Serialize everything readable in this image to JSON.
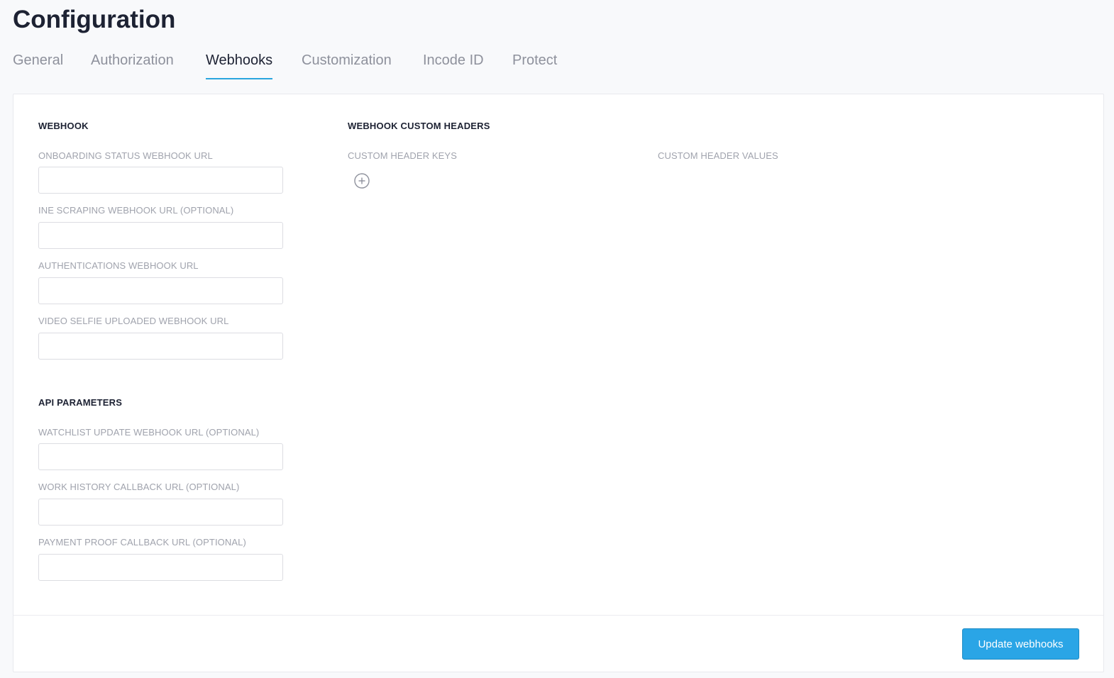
{
  "page": {
    "title": "Configuration"
  },
  "tabs": [
    {
      "label": "General",
      "active": false
    },
    {
      "label": "Authorization",
      "active": false
    },
    {
      "label": "Webhooks",
      "active": true
    },
    {
      "label": "Customization",
      "active": false
    },
    {
      "label": "Incode ID",
      "active": false
    },
    {
      "label": "Protect",
      "active": false
    }
  ],
  "webhook": {
    "title": "WEBHOOK",
    "fields": [
      {
        "label": "ONBOARDING STATUS WEBHOOK URL",
        "value": ""
      },
      {
        "label": "INE SCRAPING WEBHOOK URL (OPTIONAL)",
        "value": ""
      },
      {
        "label": "AUTHENTICATIONS WEBHOOK URL",
        "value": ""
      },
      {
        "label": "VIDEO SELFIE UPLOADED WEBHOOK URL",
        "value": ""
      }
    ]
  },
  "api_parameters": {
    "title": "API PARAMETERS",
    "fields": [
      {
        "label": "WATCHLIST UPDATE WEBHOOK URL (OPTIONAL)",
        "value": ""
      },
      {
        "label": "WORK HISTORY CALLBACK URL (OPTIONAL)",
        "value": ""
      },
      {
        "label": "PAYMENT PROOF CALLBACK URL (OPTIONAL)",
        "value": ""
      }
    ]
  },
  "custom_headers": {
    "title": "WEBHOOK CUSTOM HEADERS",
    "keys_label": "CUSTOM HEADER KEYS",
    "values_label": "CUSTOM HEADER VALUES",
    "add_icon": "plus-circle-icon"
  },
  "footer": {
    "update_label": "Update webhooks"
  },
  "colors": {
    "accent": "#2aa5e6",
    "text": "#1d2233",
    "muted": "#8e919c"
  }
}
